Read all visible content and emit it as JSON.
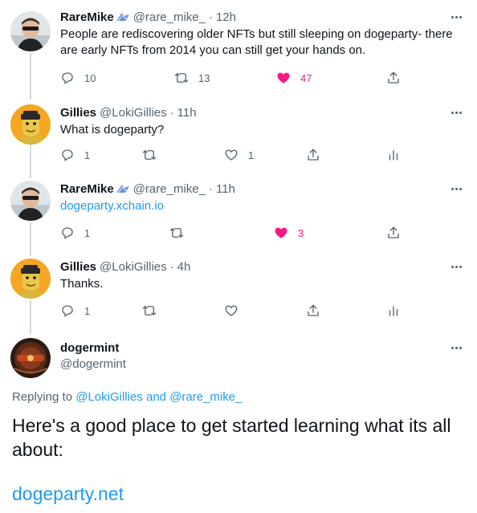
{
  "tweets": [
    {
      "name": "RareMike",
      "handle": "@rare_mike_",
      "dot": "·",
      "time": "12h",
      "text": "People are rediscovering older NFTs but still sleeping on dogeparty- there are early NFTs from 2014 you can still get your hands on.",
      "replies": "10",
      "retweets": "13",
      "likes": "47"
    },
    {
      "name": "Gillies",
      "handle": "@LokiGillies",
      "dot": "·",
      "time": "11h",
      "text": "What is dogeparty?",
      "replies": "1",
      "likes": "1"
    },
    {
      "name": "RareMike",
      "handle": "@rare_mike_",
      "dot": "·",
      "time": "11h",
      "link_text": "dogeparty.xchain.io",
      "replies": "1",
      "likes": "3"
    },
    {
      "name": "Gillies",
      "handle": "@LokiGillies",
      "dot": "·",
      "time": "4h",
      "text": "Thanks.",
      "replies": "1"
    }
  ],
  "main_tweet": {
    "name": "dogermint",
    "handle": "@dogermint",
    "replying_prefix": "Replying to ",
    "replying_user1": "@LokiGillies",
    "replying_and": " and ",
    "replying_user2": "@rare_mike_",
    "text": "Here's a good place to get started learning what its all about:",
    "link": "dogeparty.net"
  },
  "colors": {
    "accent": "#1d9bf0",
    "like": "#f91880",
    "secondary_text": "#536471",
    "thread_line": "#cfd9de"
  }
}
